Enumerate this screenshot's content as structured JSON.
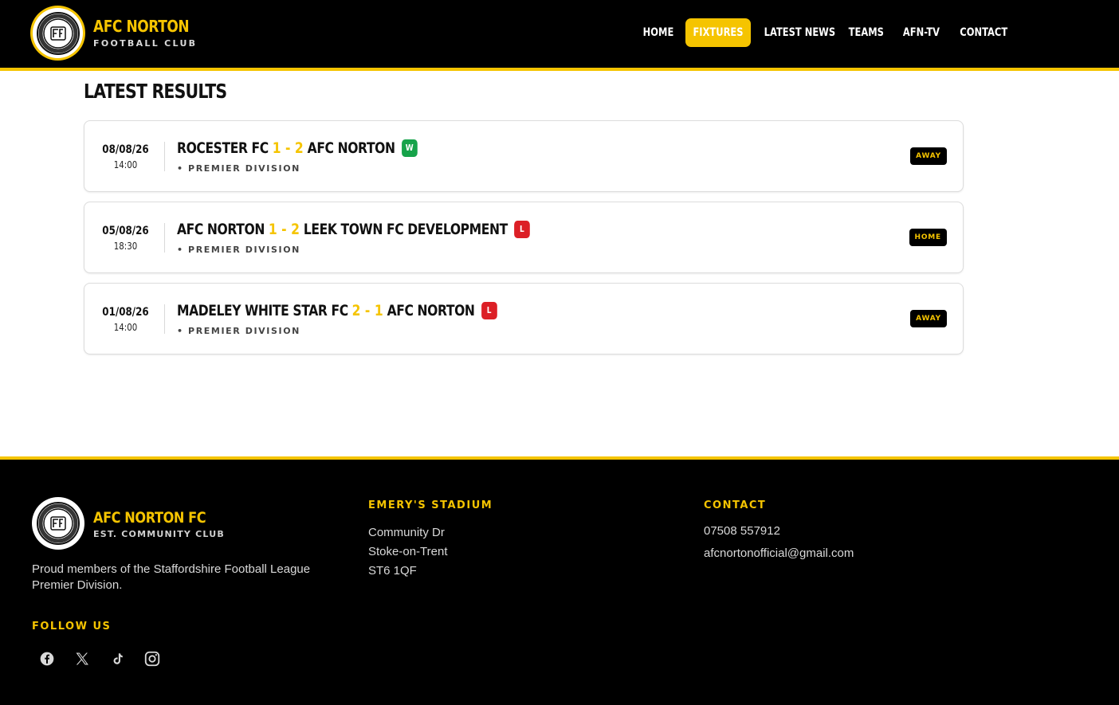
{
  "header": {
    "brand_title": "AFC NORTON",
    "brand_subtitle": "FOOTBALL CLUB",
    "nav": [
      {
        "label": "HOME",
        "active": false
      },
      {
        "label": "FIXTURES",
        "active": true
      },
      {
        "label": "LATEST NEWS",
        "active": false
      },
      {
        "label": "TEAMS",
        "active": false
      },
      {
        "label": "AFN-TV",
        "active": false
      },
      {
        "label": "CONTACT",
        "active": false
      }
    ]
  },
  "main": {
    "title": "LATEST RESULTS",
    "results": [
      {
        "date": "08/08/26",
        "time": "14:00",
        "home": "ROCESTER FC",
        "home_score": "1",
        "away_score": "2",
        "away": "AFC NORTON",
        "outcome": "W",
        "division": "• PREMIER DIVISION",
        "venue": "AWAY"
      },
      {
        "date": "05/08/26",
        "time": "18:30",
        "home": "AFC NORTON",
        "home_score": "1",
        "away_score": "2",
        "away": "LEEK TOWN FC DEVELOPMENT",
        "outcome": "L",
        "division": "• PREMIER DIVISION",
        "venue": "HOME"
      },
      {
        "date": "01/08/26",
        "time": "14:00",
        "home": "MADELEY WHITE STAR FC",
        "home_score": "2",
        "away_score": "1",
        "away": "AFC NORTON",
        "outcome": "L",
        "division": "• PREMIER DIVISION",
        "venue": "AWAY"
      }
    ],
    "score_separator": "-"
  },
  "footer": {
    "brand_title": "AFC NORTON FC",
    "brand_subtitle": "EST. COMMUNITY CLUB",
    "description": "Proud members of the Staffordshire Football League Premier Division.",
    "follow_heading": "FOLLOW US",
    "social_icons": [
      "facebook-icon",
      "x-icon",
      "tiktok-icon",
      "instagram-icon"
    ],
    "stadium_heading": "EMERY'S STADIUM",
    "address": [
      "Community Dr",
      "Stoke-on-Trent",
      "ST6 1QF"
    ],
    "contact_heading": "CONTACT",
    "phone": "07508 557912",
    "email": "afcnortonofficial@gmail.com"
  },
  "colors": {
    "accent": "#f5c400",
    "background_dark": "#000000",
    "win": "#16a34a",
    "loss": "#dc1f26"
  }
}
